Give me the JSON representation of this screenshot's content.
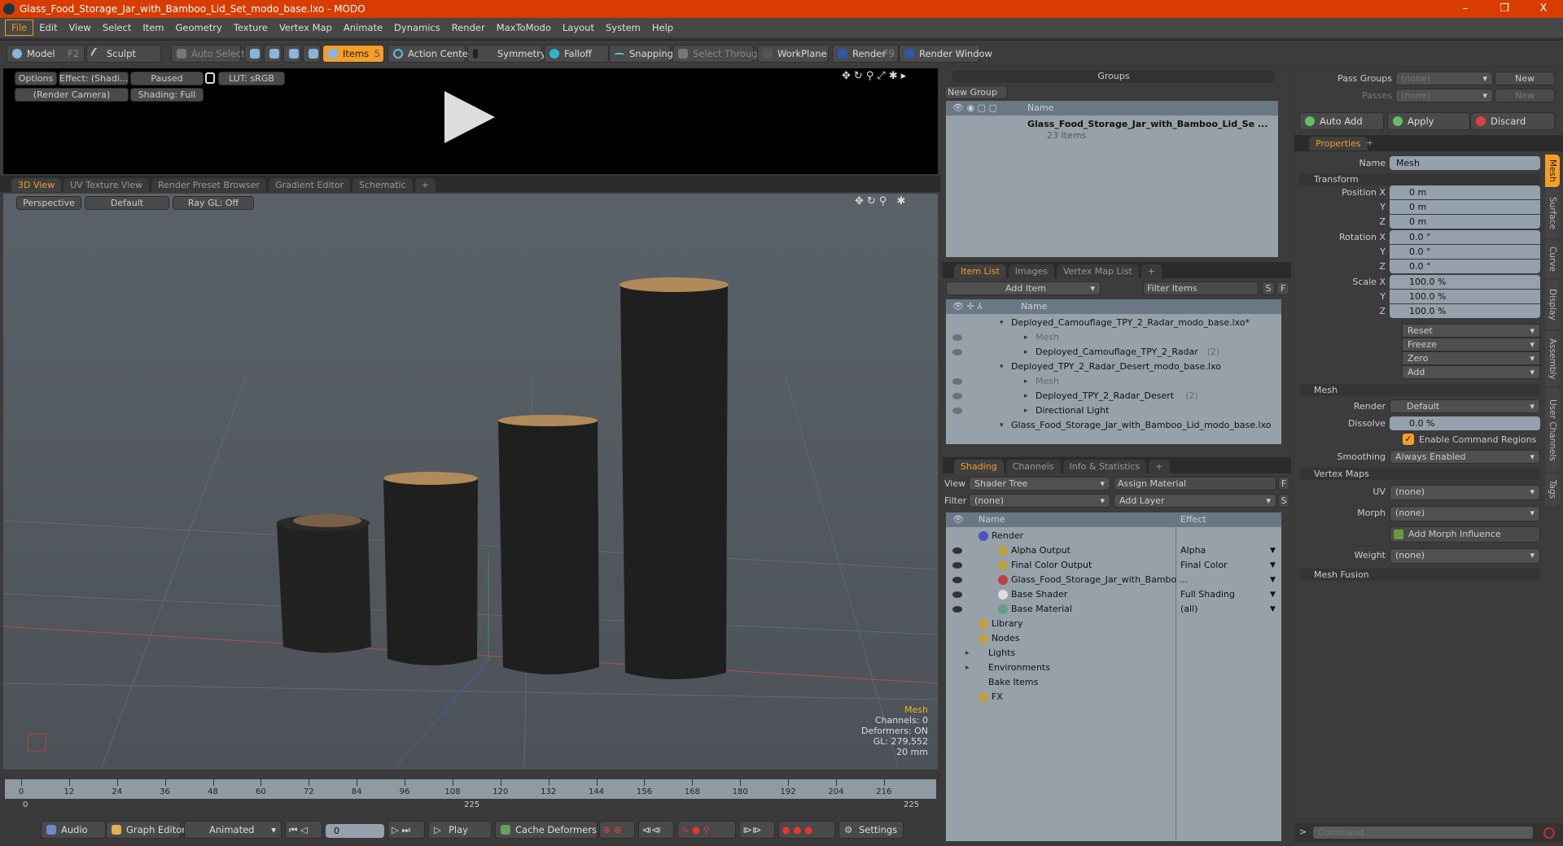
{
  "window": {
    "title": "Glass_Food_Storage_Jar_with_Bamboo_Lid_Set_modo_base.lxo - MODO",
    "controls": [
      "–",
      "❐",
      "X"
    ]
  },
  "menu": [
    "File",
    "Edit",
    "View",
    "Select",
    "Item",
    "Geometry",
    "Texture",
    "Vertex Map",
    "Animate",
    "Dynamics",
    "Render",
    "MaxToModo",
    "Layout",
    "System",
    "Help"
  ],
  "toolbar": {
    "model": "Model",
    "model_key": "F2",
    "sculpt": "Sculpt",
    "auto_select": "Auto Select",
    "items": "Items",
    "items_key": "5",
    "action_center": "Action Center",
    "symmetry": "Symmetry",
    "falloff": "Falloff",
    "snapping": "Snapping",
    "select_through": "Select Through",
    "workplane": "WorkPlane",
    "render": "Render",
    "render_key": "F9",
    "render_window": "Render Window"
  },
  "preview": {
    "options": "Options",
    "effect": "Effect: (Shadi...",
    "paused": "Paused",
    "lut": "LUT: sRGB",
    "camera": "(Render Camera)",
    "shading": "Shading: Full"
  },
  "viewport": {
    "tabs": [
      "3D View",
      "UV Texture View",
      "Render Preset Browser",
      "Gradient Editor",
      "Schematic",
      "+"
    ],
    "perspective": "Perspective",
    "default": "Default",
    "raygl": "Ray GL: Off",
    "info": {
      "title": "Mesh",
      "channels": "Channels: 0",
      "deformers": "Deformers: ON",
      "gl": "GL: 279,552",
      "scale": "20 mm"
    },
    "accent": "#f5b52a"
  },
  "timeline": {
    "ticks": [
      "0",
      "12",
      "24",
      "36",
      "48",
      "60",
      "72",
      "84",
      "96",
      "108",
      "120",
      "132",
      "144",
      "156",
      "168",
      "180",
      "192",
      "204",
      "216"
    ],
    "range_start": "0",
    "range_mid": "225",
    "range_end": "225"
  },
  "bottombar": {
    "audio": "Audio",
    "graph_editor": "Graph Editor",
    "animated": "Animated",
    "frame": "0",
    "play": "Play",
    "cache": "Cache Deformers",
    "settings": "Settings"
  },
  "groups": {
    "title": "Groups",
    "new_group": "New Group",
    "col_name": "Name",
    "item_name": "Glass_Food_Storage_Jar_with_Bamboo_Lid_Se ...",
    "item_count": "23 Items"
  },
  "itemlist": {
    "tabs": [
      "Item List",
      "Images",
      "Vertex Map List",
      "+"
    ],
    "add_item": "Add Item",
    "filter": "Filter Items",
    "s": "S",
    "f": "F",
    "col_name": "Name",
    "rows": [
      {
        "text": "Deployed_Camouflage_TPY_2_Radar_modo_base.lxo*",
        "indent": 0,
        "eye": false
      },
      {
        "text": "Mesh",
        "indent": 1,
        "eye": true,
        "dim": true
      },
      {
        "text": "Deployed_Camouflage_TPY_2_Radar",
        "count": "(2)",
        "indent": 1,
        "eye": true
      },
      {
        "text": "Deployed_TPY_2_Radar_Desert_modo_base.lxo",
        "indent": 0,
        "eye": false
      },
      {
        "text": "Mesh",
        "indent": 1,
        "eye": true,
        "dim": true
      },
      {
        "text": "Deployed_TPY_2_Radar_Desert",
        "count": "(2)",
        "indent": 1,
        "eye": true
      },
      {
        "text": "Directional Light",
        "indent": 1,
        "eye": true
      },
      {
        "text": "Glass_Food_Storage_Jar_with_Bamboo_Lid_modo_base.lxo",
        "indent": 0,
        "eye": false
      }
    ]
  },
  "shading": {
    "tabs": [
      "Shading",
      "Channels",
      "Info & Statistics",
      "+"
    ],
    "view_label": "View",
    "view": "Shader Tree",
    "assign": "Assign Material",
    "filter_label": "Filter",
    "filter": "(none)",
    "add_layer": "Add Layer",
    "f": "F",
    "s": "S",
    "col_name": "Name",
    "col_effect": "Effect",
    "rows": [
      {
        "name": "Render",
        "effect": "",
        "indent": 0,
        "eye": false
      },
      {
        "name": "Alpha Output",
        "effect": "Alpha",
        "indent": 1,
        "eye": true
      },
      {
        "name": "Final Color Output",
        "effect": "Final Color",
        "indent": 1,
        "eye": true
      },
      {
        "name": "Glass_Food_Storage_Jar_with_Bambo ...",
        "effect": "",
        "indent": 1,
        "eye": true
      },
      {
        "name": "Base Shader",
        "effect": "Full Shading",
        "indent": 1,
        "eye": true
      },
      {
        "name": "Base Material",
        "effect": "(all)",
        "indent": 1,
        "eye": true
      },
      {
        "name": "Library",
        "effect": "",
        "indent": 0,
        "eye": false
      },
      {
        "name": "Nodes",
        "effect": "",
        "indent": 0,
        "eye": false
      },
      {
        "name": "Lights",
        "effect": "",
        "indent": -1,
        "eye": false
      },
      {
        "name": "Environments",
        "effect": "",
        "indent": -1,
        "eye": false
      },
      {
        "name": "Bake Items",
        "effect": "",
        "indent": -1,
        "eye": false
      },
      {
        "name": "FX",
        "effect": "",
        "indent": 0,
        "eye": false
      }
    ]
  },
  "passes": {
    "pass_groups": "Pass Groups",
    "passes": "Passes",
    "none": "(none)",
    "new": "New",
    "auto_add": "Auto Add",
    "apply": "Apply",
    "discard": "Discard"
  },
  "properties": {
    "tab": "Properties",
    "name_label": "Name",
    "name": "Mesh",
    "transform": "Transform",
    "position": [
      "0 m",
      "0 m",
      "0 m"
    ],
    "rotation": [
      "0.0 °",
      "0.0 °",
      "0.0 °"
    ],
    "scale": [
      "100.0 %",
      "100.0 %",
      "100.0 %"
    ],
    "labels": {
      "px": "Position X",
      "rx": "Rotation X",
      "sx": "Scale X",
      "y": "Y",
      "z": "Z"
    },
    "actions": [
      "Reset",
      "Freeze",
      "Zero",
      "Add"
    ],
    "mesh": "Mesh",
    "render_label": "Render",
    "render": "Default",
    "dissolve_label": "Dissolve",
    "dissolve": "0.0 %",
    "command_regions": "Enable Command Regions",
    "command_regions_checked": true,
    "smoothing_label": "Smoothing",
    "smoothing": "Always Enabled",
    "vertex_maps": "Vertex Maps",
    "uv_label": "UV",
    "uv": "(none)",
    "morph_label": "Morph",
    "morph": "(none)",
    "add_morph": "Add Morph Influence",
    "weight_label": "Weight",
    "weight": "(none)",
    "mesh_fusion": "Mesh Fusion",
    "side_tabs": [
      "Mesh",
      "Surface",
      "Curve",
      "Display",
      "Assembly",
      "User Channels",
      "Tags"
    ]
  },
  "command": {
    "placeholder": "Command"
  }
}
